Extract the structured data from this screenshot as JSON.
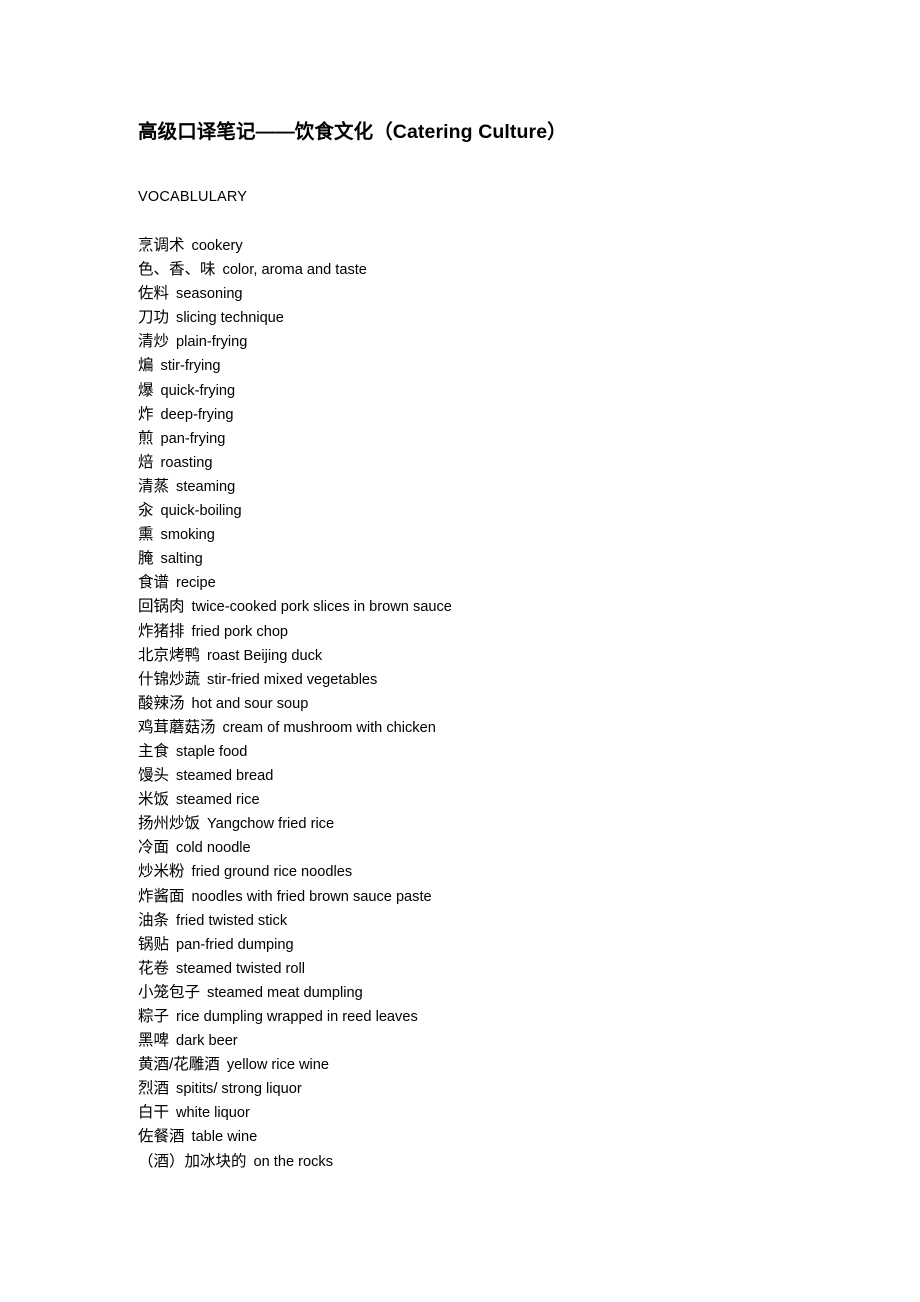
{
  "document": {
    "title": "高级口译笔记——饮食文化（Catering Culture）",
    "section_label": "VOCABLULARY",
    "vocabulary": [
      {
        "term": "烹调术",
        "gloss": "cookery"
      },
      {
        "term": "色、香、味",
        "gloss": "color, aroma and taste"
      },
      {
        "term": "佐料",
        "gloss": "seasoning"
      },
      {
        "term": "刀功",
        "gloss": "slicing technique"
      },
      {
        "term": "清炒",
        "gloss": "plain-frying"
      },
      {
        "term": "煸",
        "gloss": "stir-frying"
      },
      {
        "term": "爆",
        "gloss": "quick-frying"
      },
      {
        "term": "炸",
        "gloss": "deep-frying"
      },
      {
        "term": "煎",
        "gloss": "pan-frying"
      },
      {
        "term": "焙",
        "gloss": "roasting"
      },
      {
        "term": "清蒸",
        "gloss": "steaming"
      },
      {
        "term": "汆",
        "gloss": "quick-boiling"
      },
      {
        "term": "熏",
        "gloss": "smoking"
      },
      {
        "term": "腌",
        "gloss": "salting"
      },
      {
        "term": "食谱",
        "gloss": "recipe"
      },
      {
        "term": "回锅肉",
        "gloss": "twice-cooked pork slices in brown sauce"
      },
      {
        "term": "炸猪排",
        "gloss": "fried pork chop"
      },
      {
        "term": "北京烤鸭",
        "gloss": "roast Beijing duck"
      },
      {
        "term": "什锦炒蔬",
        "gloss": "stir-fried mixed vegetables"
      },
      {
        "term": "酸辣汤",
        "gloss": "hot and sour soup"
      },
      {
        "term": "鸡茸蘑菇汤",
        "gloss": "cream of mushroom with chicken"
      },
      {
        "term": "主食",
        "gloss": "staple food"
      },
      {
        "term": "馒头",
        "gloss": "steamed bread"
      },
      {
        "term": "米饭",
        "gloss": "steamed rice"
      },
      {
        "term": "扬州炒饭",
        "gloss": "Yangchow fried rice"
      },
      {
        "term": "冷面",
        "gloss": "cold noodle"
      },
      {
        "term": "炒米粉",
        "gloss": "fried ground rice noodles"
      },
      {
        "term": "炸酱面",
        "gloss": "noodles with fried brown sauce paste"
      },
      {
        "term": "油条",
        "gloss": "fried twisted stick"
      },
      {
        "term": "锅贴",
        "gloss": "pan-fried dumping"
      },
      {
        "term": "花卷",
        "gloss": "steamed twisted roll"
      },
      {
        "term": "小笼包子",
        "gloss": "steamed meat dumpling"
      },
      {
        "term": "粽子",
        "gloss": "rice dumpling wrapped in reed leaves"
      },
      {
        "term": "黑啤",
        "gloss": "dark beer"
      },
      {
        "term": "黄酒/花雕酒",
        "gloss": "yellow rice wine"
      },
      {
        "term": "烈酒",
        "gloss": "spitits/ strong liquor"
      },
      {
        "term": "白干",
        "gloss": "white liquor"
      },
      {
        "term": "佐餐酒",
        "gloss": "table wine"
      },
      {
        "term": "（酒）加冰块的",
        "gloss": "on the rocks"
      }
    ]
  }
}
